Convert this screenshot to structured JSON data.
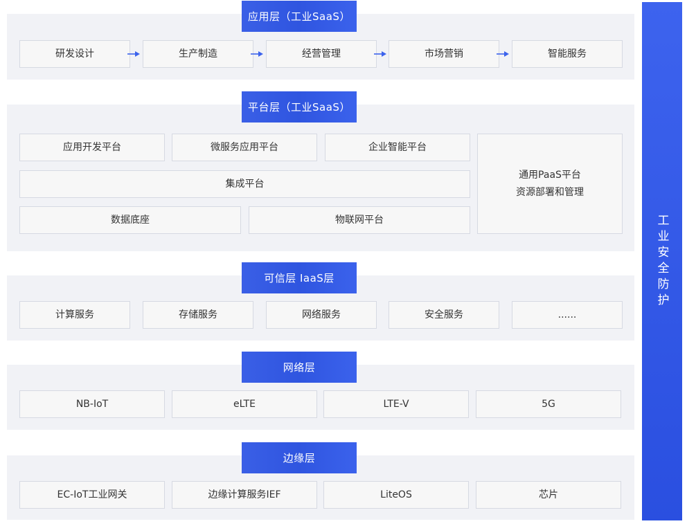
{
  "layers": {
    "app": {
      "title": "应用层（工业SaaS）",
      "items": [
        "研发设计",
        "生产制造",
        "经营管理",
        "市场营销",
        "智能服务"
      ]
    },
    "platform": {
      "title": "平台层（工业SaaS）",
      "items": [
        "应用开发平台",
        "微服务应用平台",
        "企业智能平台",
        "集成平台",
        "数据底座",
        "物联网平台"
      ],
      "paas_line1": "通用PaaS平台",
      "paas_line2": "资源部署和管理"
    },
    "iaas": {
      "title": "可信层 IaaS层",
      "items": [
        "计算服务",
        "存储服务",
        "网络服务",
        "安全服务",
        "......"
      ]
    },
    "network": {
      "title": "网络层",
      "items": [
        "NB-IoT",
        "eLTE",
        "LTE-V",
        "5G"
      ]
    },
    "edge": {
      "title": "边缘层",
      "items": [
        "EC-IoT工业网关",
        "边缘计算服务IEF",
        "LiteOS",
        "芯片"
      ]
    }
  },
  "side": {
    "label": "工业安全防护"
  },
  "colors": {
    "accent": "#2f55e0",
    "panel": "#f1f2f6",
    "box_border": "#d6d9e2"
  }
}
